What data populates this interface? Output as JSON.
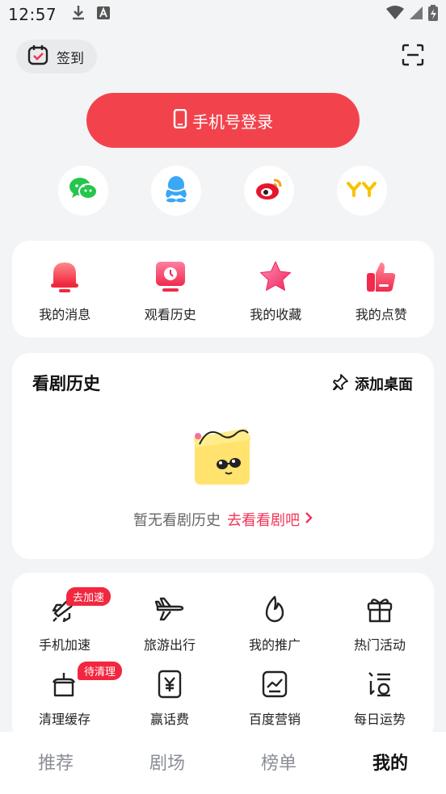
{
  "status": {
    "time": "12:57"
  },
  "top": {
    "checkin_label": "签到"
  },
  "login": {
    "label": "手机号登录"
  },
  "social": [
    "wechat-icon",
    "qq-icon",
    "weibo-icon",
    "yy-icon"
  ],
  "quick": [
    {
      "label": "我的消息",
      "icon": "bell-icon"
    },
    {
      "label": "观看历史",
      "icon": "history-clock-icon"
    },
    {
      "label": "我的收藏",
      "icon": "star-icon"
    },
    {
      "label": "我的点赞",
      "icon": "thumbs-up-icon"
    }
  ],
  "history": {
    "title": "看剧历史",
    "pin_label": "添加桌面",
    "empty_text": "暂无看剧历史",
    "empty_link": "去看看剧吧"
  },
  "tools": [
    {
      "label": "手机加速",
      "tag": "去加速",
      "icon": "rocket-icon"
    },
    {
      "label": "旅游出行",
      "icon": "airplane-icon"
    },
    {
      "label": "我的推广",
      "icon": "flame-icon"
    },
    {
      "label": "热门活动",
      "icon": "gift-icon"
    },
    {
      "label": "清理缓存",
      "tag": "待清理",
      "icon": "broom-icon"
    },
    {
      "label": "赢话费",
      "icon": "yen-card-icon"
    },
    {
      "label": "百度营销",
      "icon": "chart-card-icon"
    },
    {
      "label": "每日运势",
      "icon": "fortune-icon"
    }
  ],
  "tabs": [
    {
      "label": "推荐"
    },
    {
      "label": "剧场"
    },
    {
      "label": "榜单"
    },
    {
      "label": "我的",
      "active": true
    }
  ],
  "colors": {
    "accent": "#f2434d",
    "link": "#f0365a",
    "tag": "#f2273f",
    "bg": "#f3f4f6"
  }
}
